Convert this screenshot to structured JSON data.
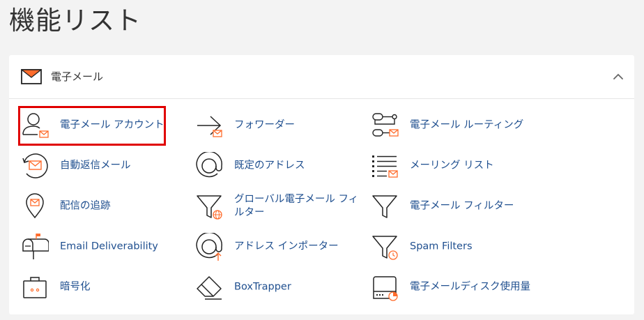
{
  "page": {
    "title": "機能リスト"
  },
  "section": {
    "title": "電子メール",
    "header_icon": "envelope-icon",
    "collapse_icon": "chevron-up-icon"
  },
  "colors": {
    "accent": "#ff6c2c",
    "link": "#1f4f8f",
    "highlight": "#e00000"
  },
  "items": [
    {
      "label": "電子メール アカウント",
      "icon": "user-mail-icon"
    },
    {
      "label": "フォワーダー",
      "icon": "forward-arrow-icon"
    },
    {
      "label": "電子メール ルーティング",
      "icon": "routing-icon"
    },
    {
      "label": "自動返信メール",
      "icon": "autoresponder-icon"
    },
    {
      "label": "既定のアドレス",
      "icon": "at-sign-icon"
    },
    {
      "label": "メーリング リスト",
      "icon": "list-mail-icon"
    },
    {
      "label": "配信の追跡",
      "icon": "location-pin-icon"
    },
    {
      "label": "グローバル電子メール フィルター",
      "icon": "funnel-globe-icon"
    },
    {
      "label": "電子メール フィルター",
      "icon": "funnel-icon"
    },
    {
      "label": "Email Deliverability",
      "icon": "mailbox-icon"
    },
    {
      "label": "アドレス インポーター",
      "icon": "at-import-icon"
    },
    {
      "label": "Spam Filters",
      "icon": "funnel-clock-icon"
    },
    {
      "label": "暗号化",
      "icon": "briefcase-icon"
    },
    {
      "label": "BoxTrapper",
      "icon": "eraser-icon"
    },
    {
      "label": "電子メールディスク使用量",
      "icon": "disk-usage-icon"
    }
  ]
}
